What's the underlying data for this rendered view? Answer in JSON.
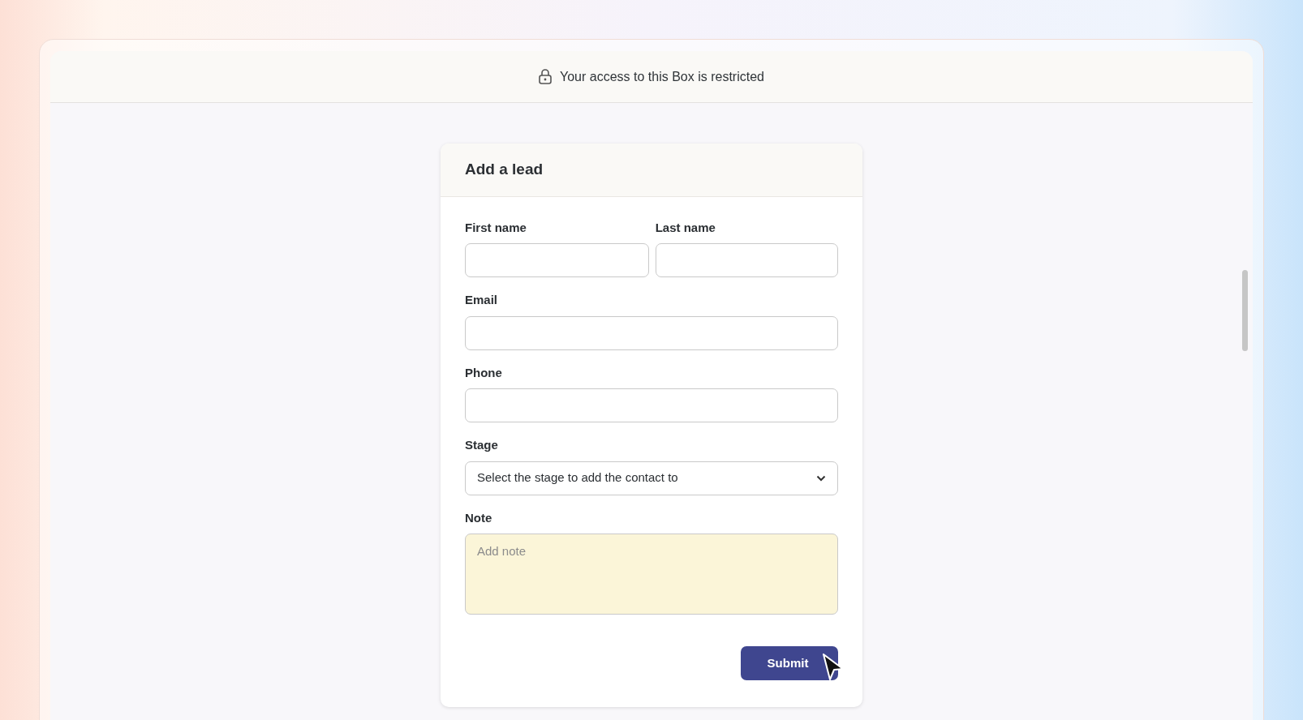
{
  "banner": {
    "text": "Your access to this Box is restricted"
  },
  "form": {
    "title": "Add a lead",
    "rows": [
      [
        {
          "kind": "text",
          "label": "First name"
        },
        {
          "kind": "text",
          "label": "Last name"
        }
      ],
      [
        {
          "kind": "text",
          "label": "Email"
        }
      ],
      [
        {
          "kind": "text",
          "label": "Phone"
        }
      ],
      [
        {
          "kind": "select",
          "label": "Stage",
          "value": "Select the stage to add the contact to"
        }
      ],
      [
        {
          "kind": "textarea",
          "label": "Note",
          "placeholder": "Add note"
        }
      ]
    ],
    "submit": "Submit"
  }
}
